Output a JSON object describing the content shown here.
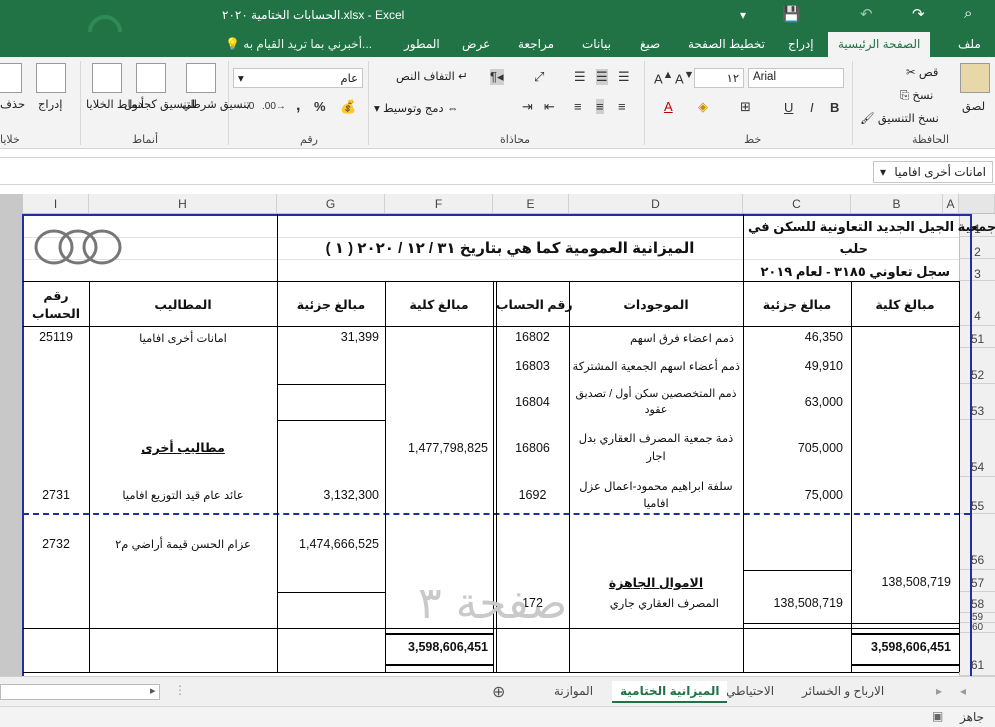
{
  "title": {
    "text": "الحسابات الختامية ٢٠٢٠.xlsx - Excel",
    "qa_save": "💾",
    "qa_undo": "↶",
    "qa_redo": "↷",
    "qa_custom": "▾"
  },
  "tabs": [
    "ملف",
    "الصفحة الرئيسية",
    "إدراج",
    "تخطيط الصفحة",
    "صيغ",
    "بيانات",
    "مراجعة",
    "عرض",
    "المطور"
  ],
  "tellme": "أخبرني بما تريد القيام به...",
  "ribbon": {
    "clipboard": {
      "paste": "لصق",
      "cut": "قص",
      "copy": "نسخ",
      "format_painter": "نسخ التنسيق",
      "label": "الحافظة"
    },
    "font": {
      "name": "Arial",
      "size": "١٢",
      "bold": "B",
      "italic": "I",
      "underline": "U",
      "label": "خط"
    },
    "alignment": {
      "wrap": "التفاف النص",
      "merge": "دمج وتوسيط",
      "label": "محاذاة"
    },
    "number": {
      "format": "عام",
      "percent": "%",
      "comma": ",",
      "label": "رقم"
    },
    "styles": {
      "conditional": "تنسيق شرطي",
      "as_table": "التنسيق كجدول",
      "cell_styles": "أنماط الخلايا",
      "label": "أنماط"
    },
    "cells": {
      "insert": "إدراج",
      "delete": "حذف",
      "label": "خلايا"
    }
  },
  "formula_bar": {
    "value": "امانات أخرى افاميا"
  },
  "columns": [
    "A",
    "B",
    "C",
    "D",
    "E",
    "F",
    "G",
    "H",
    "I"
  ],
  "rows": [
    "1",
    "2",
    "3",
    "4",
    "51",
    "52",
    "53",
    "54",
    "55",
    "56",
    "57",
    "58",
    "59",
    "60",
    "61"
  ],
  "sheet": {
    "org_line1": "جمعية الجيل الجديد التعاونية للسكن في",
    "org_line2": "حلب",
    "registry": "سجل تعاوني ٣١٨٥ - لعام ٢٠١٩",
    "heading": "الميزانية العمومية كما هي بتاريخ ٣١ / ١٢ / ٢٠٢٠ ( ١ )",
    "headers": {
      "b": "مبالغ كلية",
      "c": "مبالغ جزئية",
      "d": "الموجودات",
      "e": "رقم الحساب",
      "f": "مبالغ كلية",
      "g": "مبالغ جزئية",
      "h": "المطاليب",
      "i_line1": "رقم",
      "i_line2": "الحساب"
    },
    "r51": {
      "c": "46,350",
      "d": "ذمم اعضاء فرق اسهم",
      "e": "16802",
      "g": "31,399",
      "h": "امانات أخرى افاميا",
      "i": "25119"
    },
    "r52": {
      "c": "49,910",
      "d": "ذمم أعضاء اسهم الجمعية المشتركة",
      "e": "16803"
    },
    "r53": {
      "c": "63,000",
      "d1": "ذمم المتخصصين سكن أول / تصديق",
      "d2": "عقود",
      "e": "16804"
    },
    "r54": {
      "c": "705,000",
      "d1": "ذمة جمعية المصرف العقاري بدل",
      "d2": "اجار",
      "e": "16806",
      "f": "1,477,798,825",
      "h": "مطاليب أخرى"
    },
    "r55": {
      "c": "75,000",
      "d1": "سلفة ابراهيم محمود-اعمال عزل",
      "d2": "افاميا",
      "e": "1692",
      "g": "3,132,300",
      "h": "عائد عام قيد التوزيع افاميا",
      "i": "2731"
    },
    "r56": {
      "g": "1,474,666,525",
      "h": "عزام الحسن قيمة أراضي م٢",
      "i": "2732"
    },
    "r57": {
      "b": "138,508,719",
      "d": "الاموال الجاهزة"
    },
    "r58": {
      "c": "138,508,719",
      "d": "المصرف العقاري جاري",
      "e": "172"
    },
    "r61": {
      "b": "3,598,606,451",
      "f": "3,598,606,451"
    },
    "watermark": "صفحة ٣"
  },
  "sheet_tabs": [
    "الموازنة",
    "الميزانية الختامية",
    "الاحتياطي",
    "الارباح و الخسائر"
  ],
  "status": {
    "ready": "جاهز"
  }
}
